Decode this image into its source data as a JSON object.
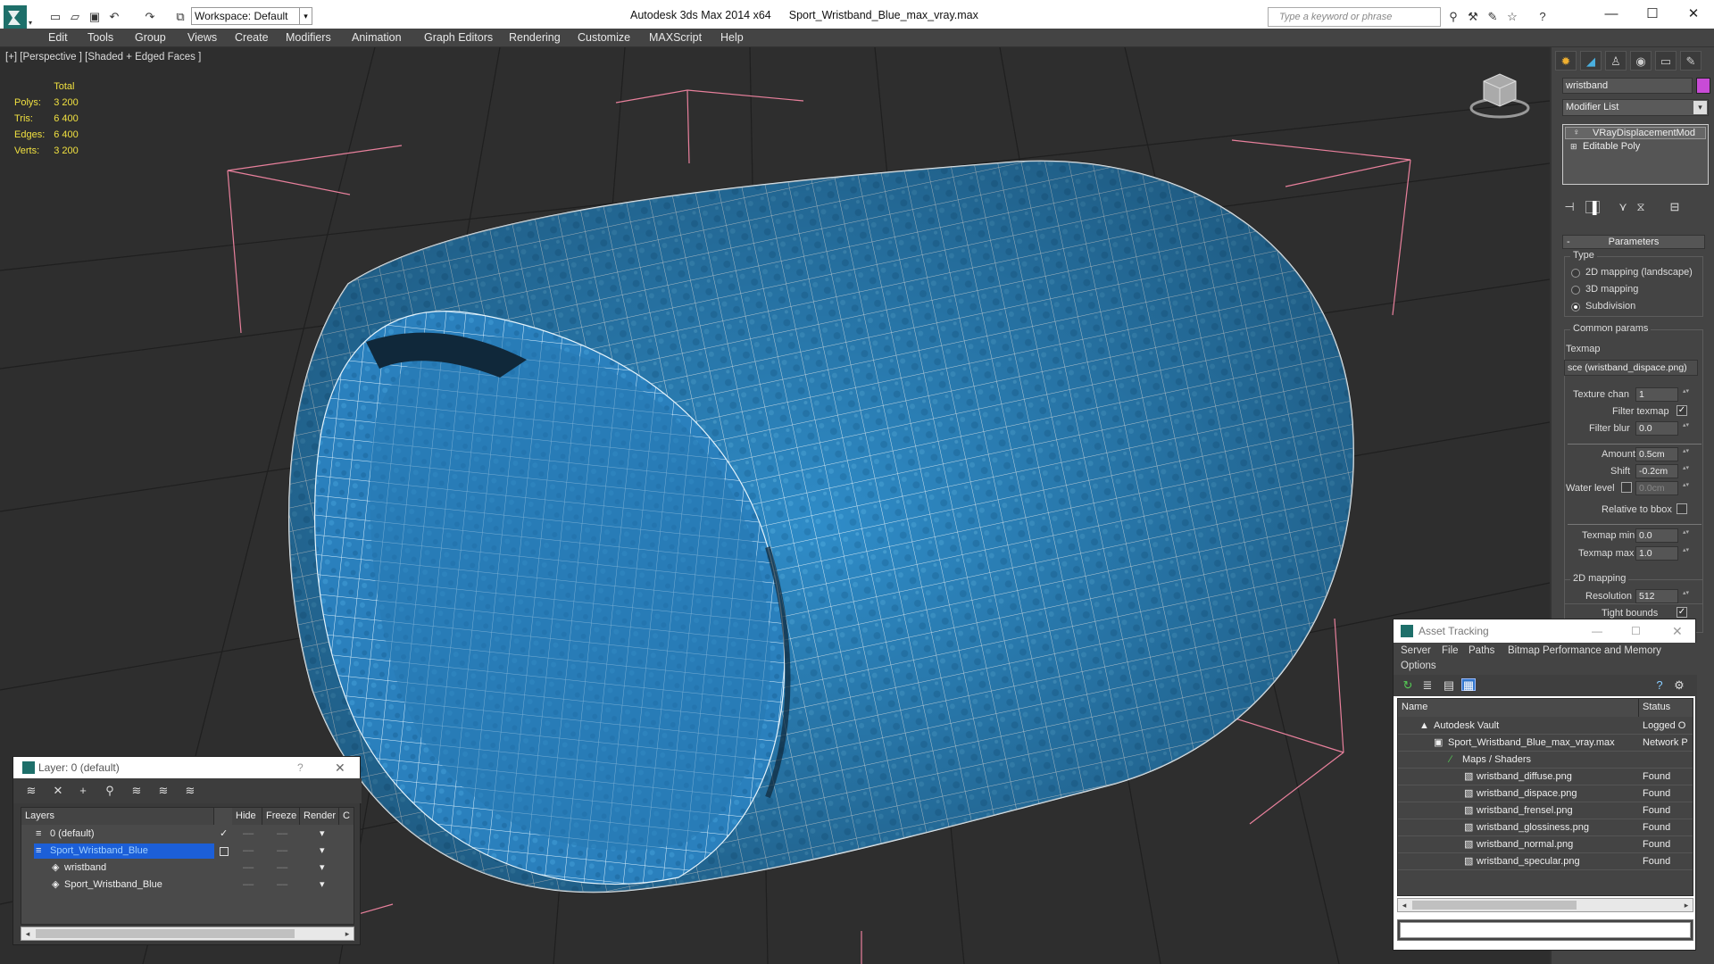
{
  "app": {
    "title": "Autodesk 3ds Max  2014 x64",
    "filename": "Sport_Wristband_Blue_max_vray.max",
    "workspace": "Workspace: Default",
    "search_placeholder": "Type a keyword or phrase"
  },
  "menu": [
    "Edit",
    "Tools",
    "Group",
    "Views",
    "Create",
    "Modifiers",
    "Animation",
    "Graph Editors",
    "Rendering",
    "Customize",
    "MAXScript",
    "Help"
  ],
  "viewport": {
    "label": "[+] [Perspective ] [Shaded + Edged Faces ]",
    "stats": {
      "header": "Total",
      "rows": [
        {
          "label": "Polys:",
          "value": "3 200"
        },
        {
          "label": "Tris:",
          "value": "6 400"
        },
        {
          "label": "Edges:",
          "value": "6 400"
        },
        {
          "label": "Verts:",
          "value": "3 200"
        }
      ]
    }
  },
  "command_panel": {
    "object_name": "wristband",
    "object_color": "#c84bd6",
    "modifier_list": "Modifier List",
    "stack": [
      "VRayDisplacementMod",
      "Editable Poly"
    ],
    "rollout": "Parameters",
    "type_label": "Type",
    "type_options": [
      {
        "label": "2D mapping (landscape)",
        "selected": false
      },
      {
        "label": "3D mapping",
        "selected": false
      },
      {
        "label": "Subdivision",
        "selected": true
      }
    ],
    "common_params": "Common params",
    "texmap_label": "Texmap",
    "texmap_value": "sce (wristband_dispace.png)",
    "texture_chan_label": "Texture chan",
    "texture_chan": "1",
    "filter_texmap_label": "Filter texmap",
    "filter_blur_label": "Filter blur",
    "filter_blur": "0.0",
    "amount_label": "Amount",
    "amount": "0.5cm",
    "shift_label": "Shift",
    "shift": "-0.2cm",
    "water_level_label": "Water level",
    "water_level": "0.0cm",
    "relative_bbox_label": "Relative to bbox",
    "texmap_min_label": "Texmap min",
    "texmap_min": "0.0",
    "texmap_max_label": "Texmap max",
    "texmap_max": "1.0",
    "mapping_2d": "2D mapping",
    "resolution_label": "Resolution",
    "resolution": "512",
    "tight_bounds_label": "Tight bounds"
  },
  "layer_dialog": {
    "title": "Layer: 0 (default)",
    "help": "?",
    "close": "✕",
    "columns": [
      "Layers",
      "Hide",
      "Freeze",
      "Render",
      "C"
    ],
    "rows": [
      {
        "name": "0 (default)",
        "indent": 0,
        "selected": false,
        "check": true
      },
      {
        "name": "Sport_Wristband_Blue",
        "indent": 0,
        "selected": true,
        "check": false
      },
      {
        "name": "wristband",
        "indent": 1,
        "selected": false,
        "check": false
      },
      {
        "name": "Sport_Wristband_Blue",
        "indent": 1,
        "selected": false,
        "check": false
      }
    ]
  },
  "asset_dialog": {
    "title": "Asset Tracking",
    "menu": [
      "Server",
      "File",
      "Paths",
      "Bitmap Performance and Memory"
    ],
    "menu2": "Options",
    "columns": [
      "Name",
      "Status"
    ],
    "rows": [
      {
        "name": "Autodesk Vault",
        "status": "Logged O",
        "indent": 1
      },
      {
        "name": "Sport_Wristband_Blue_max_vray.max",
        "status": "Network P",
        "indent": 2
      },
      {
        "name": "Maps / Shaders",
        "status": "",
        "indent": 3
      },
      {
        "name": "wristband_diffuse.png",
        "status": "Found",
        "indent": 4
      },
      {
        "name": "wristband_dispace.png",
        "status": "Found",
        "indent": 4
      },
      {
        "name": "wristband_frensel.png",
        "status": "Found",
        "indent": 4
      },
      {
        "name": "wristband_glossiness.png",
        "status": "Found",
        "indent": 4
      },
      {
        "name": "wristband_normal.png",
        "status": "Found",
        "indent": 4
      },
      {
        "name": "wristband_specular.png",
        "status": "Found",
        "indent": 4
      }
    ]
  }
}
